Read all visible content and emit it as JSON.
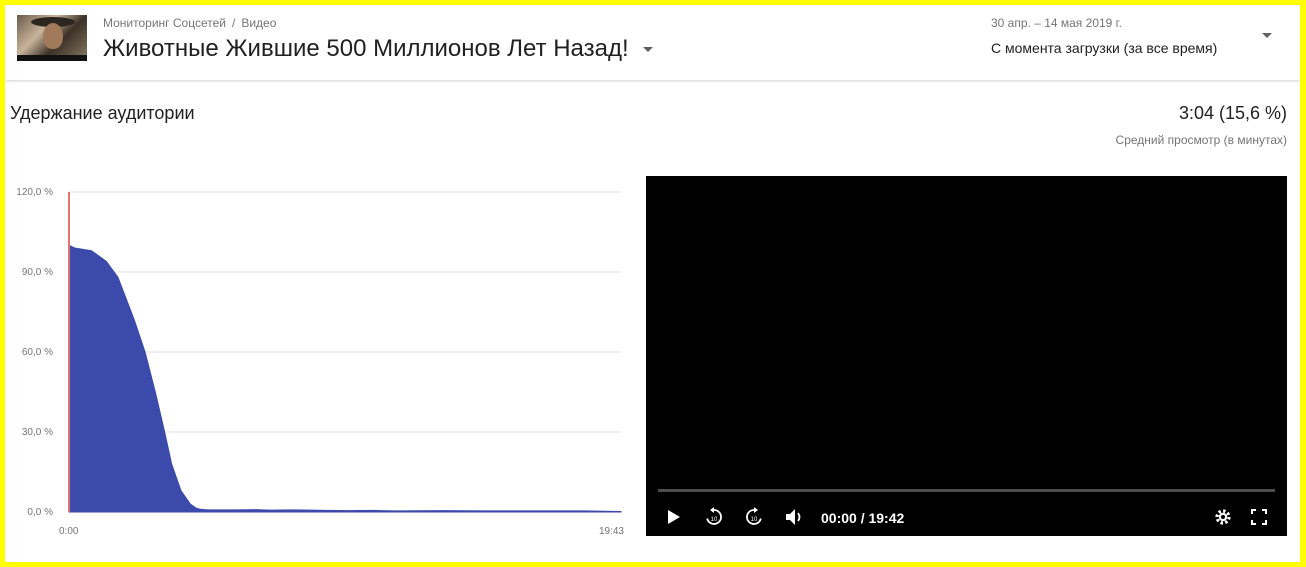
{
  "header": {
    "breadcrumb": [
      "Мониторинг Соцсетей",
      "Видео"
    ],
    "breadcrumb_separator": "/",
    "title": "Животные Жившие 500 Миллионов Лет Назад!",
    "date_range": "30 апр. – 14 мая 2019 г.",
    "period_label": "С момента загрузки (за все время)"
  },
  "retention": {
    "title": "Удержание аудитории",
    "avg_view": "3:04 (15,6 %)",
    "avg_view_label": "Средний просмотр (в минутах)"
  },
  "chart_data": {
    "type": "area",
    "title": "",
    "xlabel": "",
    "ylabel": "",
    "x_tick_labels": [
      "0:00",
      "19:43"
    ],
    "y_tick_labels": [
      "0,0 %",
      "30,0 %",
      "60,0 %",
      "90,0 %",
      "120,0 %"
    ],
    "ylim": [
      0,
      120
    ],
    "xlim_seconds": [
      0,
      1183
    ],
    "grid": true,
    "color": "#3b4aab",
    "marker_color": "#e57373",
    "marker_x_seconds": 0,
    "series": [
      {
        "x_seconds": [
          0,
          12,
          48,
          80,
          105,
          140,
          163,
          185,
          205,
          220,
          240,
          260,
          272,
          280,
          290,
          300,
          305,
          320,
          360,
          400,
          430,
          480,
          550,
          600,
          650,
          700,
          800,
          900,
          1000,
          1100,
          1183
        ],
        "values": [
          100,
          99,
          98,
          94,
          88,
          72,
          60,
          45,
          30,
          18,
          8,
          3,
          1.5,
          1.1,
          0.9,
          0.8,
          0.8,
          0.8,
          0.8,
          0.9,
          0.7,
          0.8,
          0.6,
          0.5,
          0.6,
          0.4,
          0.5,
          0.4,
          0.4,
          0.4,
          0.2
        ]
      }
    ]
  },
  "player": {
    "time": "00:00 / 19:42",
    "icons": [
      "play-icon",
      "rewind-10-icon",
      "forward-10-icon",
      "volume-icon",
      "settings-gear-icon",
      "fullscreen-icon"
    ]
  }
}
